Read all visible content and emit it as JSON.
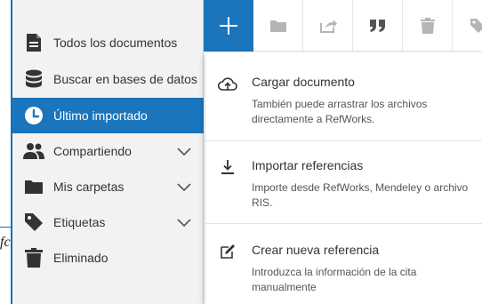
{
  "background": {
    "fragment_text": "fc"
  },
  "sidebar": {
    "items": [
      {
        "label": "Todos los documentos",
        "icon": "document-icon",
        "expandable": false,
        "active": false
      },
      {
        "label": "Buscar en bases de datos",
        "icon": "database-icon",
        "expandable": false,
        "active": false
      },
      {
        "label": "Último importado",
        "icon": "clock-icon",
        "expandable": false,
        "active": true
      },
      {
        "label": "Compartiendo",
        "icon": "users-icon",
        "expandable": true,
        "active": false
      },
      {
        "label": "Mis carpetas",
        "icon": "folder-icon",
        "expandable": true,
        "active": false
      },
      {
        "label": "Etiquetas",
        "icon": "tag-icon",
        "expandable": true,
        "active": false
      },
      {
        "label": "Eliminado",
        "icon": "trash-icon",
        "expandable": false,
        "active": false
      }
    ]
  },
  "toolbar": {
    "buttons": [
      {
        "icon": "plus-icon",
        "name": "add"
      },
      {
        "icon": "folder-icon",
        "name": "folder"
      },
      {
        "icon": "share-icon",
        "name": "share"
      },
      {
        "icon": "quote-icon",
        "name": "cite"
      },
      {
        "icon": "trash-icon",
        "name": "delete"
      },
      {
        "icon": "tag-icon",
        "name": "tag"
      }
    ]
  },
  "add_menu": {
    "items": [
      {
        "title": "Cargar documento",
        "description": "También puede arrastrar los archivos directamente a RefWorks.",
        "icon": "cloud-upload-icon"
      },
      {
        "title": "Importar referencias",
        "description": "Importe desde RefWorks, Mendeley o archivo RIS.",
        "icon": "download-icon"
      },
      {
        "title": "Crear nueva referencia",
        "description": "Introduzca la información de la cita manualmente",
        "icon": "edit-icon"
      }
    ]
  },
  "colors": {
    "accent": "#1a75bc",
    "sidebar_bg": "#f2f2f2",
    "icon_dark": "#333333",
    "toolbar_icon": "#b5b5b5"
  }
}
